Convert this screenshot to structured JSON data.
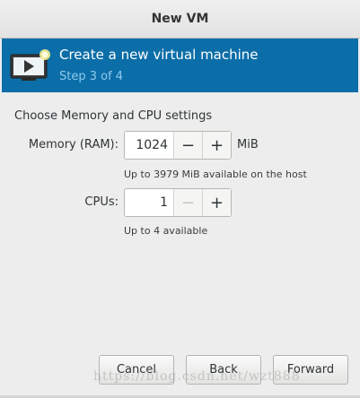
{
  "window": {
    "title": "New VM"
  },
  "banner": {
    "title": "Create a new virtual machine",
    "step": "Step 3 of 4",
    "icon": "monitor-play-icon"
  },
  "form": {
    "heading": "Choose Memory and CPU settings",
    "memory": {
      "label": "Memory (RAM):",
      "value": "1024",
      "unit": "MiB",
      "hint": "Up to 3979 MiB available on the host",
      "decrement": "−",
      "increment": "+"
    },
    "cpus": {
      "label": "CPUs:",
      "value": "1",
      "hint": "Up to 4 available",
      "decrement": "−",
      "increment": "+"
    }
  },
  "buttons": {
    "cancel": "Cancel",
    "back": "Back",
    "forward": "Forward"
  },
  "watermark": "https://blog.csdn.net/wzt888",
  "colors": {
    "banner_bg": "#0c6ea8",
    "banner_step": "#8ec9ec"
  }
}
